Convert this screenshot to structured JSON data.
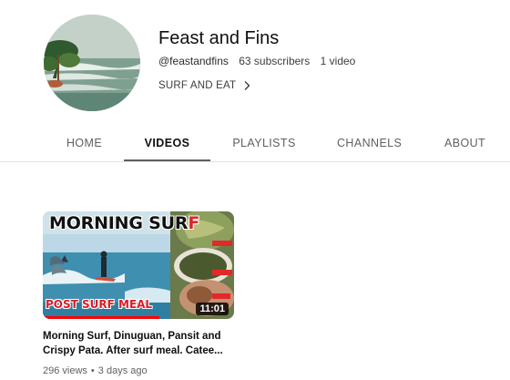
{
  "channel": {
    "title": "Feast and Fins",
    "handle": "@feastandfins",
    "subscribers": "63 subscribers",
    "video_count": "1 video",
    "tagline": "SURF AND EAT"
  },
  "tabs": [
    {
      "label": "HOME",
      "active": false
    },
    {
      "label": "VIDEOS",
      "active": true
    },
    {
      "label": "PLAYLISTS",
      "active": false
    },
    {
      "label": "CHANNELS",
      "active": false
    },
    {
      "label": "ABOUT",
      "active": false
    }
  ],
  "video": {
    "thumbnail_text_top_1": "MORNING SUR",
    "thumbnail_text_top_2": "F",
    "thumbnail_text_bottom": "POST SURF MEAL",
    "duration": "11:01",
    "watched_fraction": 0.61,
    "title": "Morning Surf, Dinuguan, Pansit and Crispy Pata. After surf meal. Catee...",
    "views": "296 views",
    "age": "3 days ago"
  },
  "colors": {
    "accent_red": "#ff0000",
    "tab_indicator": "#606060"
  }
}
